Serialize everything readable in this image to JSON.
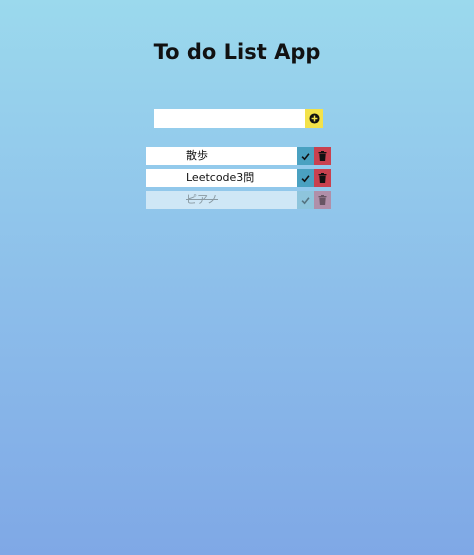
{
  "app": {
    "title": "To do List App"
  },
  "input": {
    "value": "",
    "placeholder": ""
  },
  "icons": {
    "add": "plus-circle-icon",
    "complete": "check-icon",
    "delete": "trash-icon"
  },
  "colors": {
    "add_button": "#f3e24a",
    "complete_button": "#4aa1c1",
    "delete_button": "#c9414f"
  },
  "todos": [
    {
      "text": "散歩",
      "completed": false
    },
    {
      "text": "Leetcode3問",
      "completed": false
    },
    {
      "text": "ピアノ",
      "completed": true
    }
  ]
}
